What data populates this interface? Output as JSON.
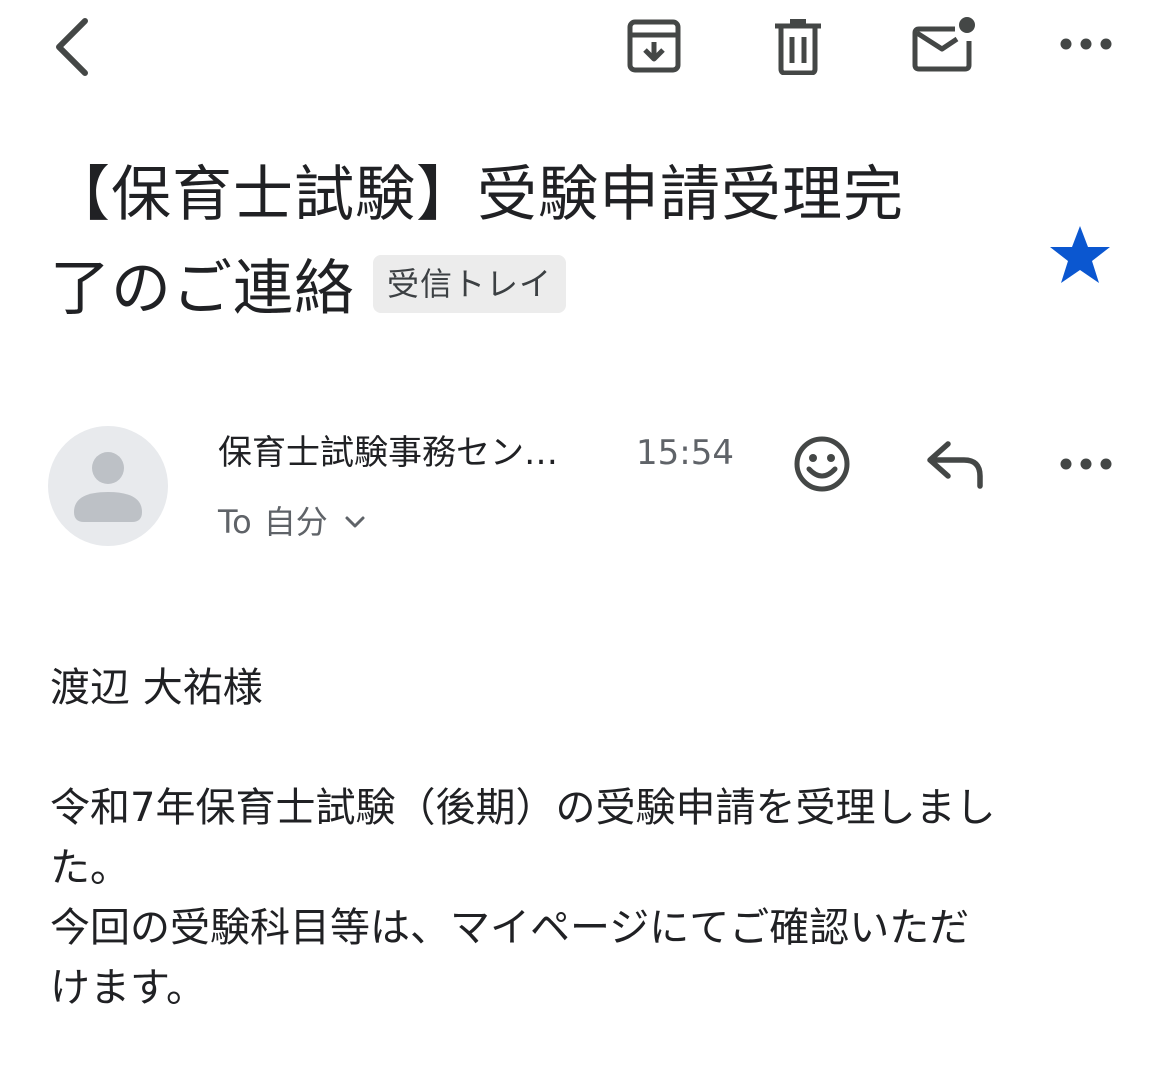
{
  "subject": {
    "line1": "【保育士試験】受験申請受理完",
    "line2": "了のご連絡",
    "label": "受信トレイ",
    "starred": true
  },
  "sender": {
    "name": "保育士試験事務セン…",
    "time": "15:54",
    "to_prefix": "To",
    "to_recipient": "自分"
  },
  "body": {
    "greeting": "渡辺 大祐様",
    "line1": "令和7年保育士試験（後期）の受験申請を受理しまし",
    "line2": "た。",
    "line3": "今回の受験科目等は、マイページにてご確認いただ",
    "line4": "けます。"
  },
  "icons": {
    "back": "arrow-back-icon",
    "archive": "archive-icon",
    "delete": "trash-icon",
    "unread": "mark-unread-icon",
    "more": "more-horizontal-icon",
    "star": "star-icon",
    "avatar": "person-avatar-icon",
    "emoji": "smiley-icon",
    "reply": "reply-icon",
    "chevron": "chevron-down-icon"
  },
  "colors": {
    "star": "#0b57d0",
    "icon": "#444746",
    "chip_bg": "#ececec",
    "avatar_bg": "#e8eaed",
    "avatar_fg": "#bdc1c6"
  }
}
